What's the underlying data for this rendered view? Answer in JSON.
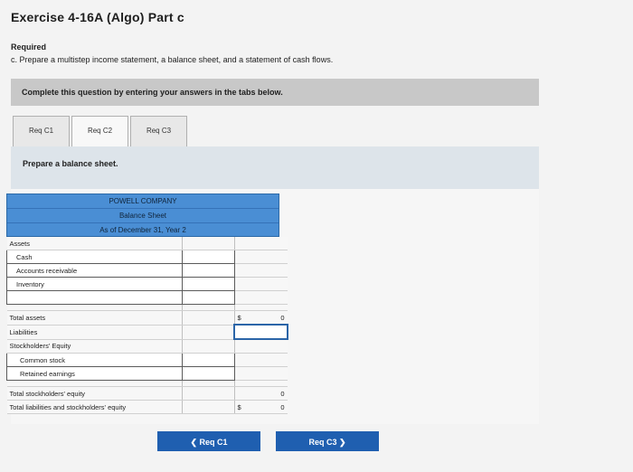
{
  "page": {
    "title": "Exercise 4-16A (Algo) Part c",
    "required_label": "Required",
    "required_text": "c. Prepare a multistep income statement, a balance sheet, and a statement of cash flows.",
    "instructions": "Complete this question by entering your answers in the tabs below."
  },
  "tabs": [
    {
      "label": "Req C1"
    },
    {
      "label": "Req C2"
    },
    {
      "label": "Req C3"
    }
  ],
  "panel": {
    "heading": "Prepare a balance sheet."
  },
  "balance_sheet": {
    "company": "POWELL COMPANY",
    "statement": "Balance Sheet",
    "date": "As of December 31, Year 2",
    "labels": {
      "assets": "Assets",
      "cash": "Cash",
      "accounts_receivable": "Accounts receivable",
      "inventory": "Inventory",
      "total_assets": "Total assets",
      "liabilities": "Liabilities",
      "stockholders_equity": "Stockholders' Equity",
      "common_stock": "Common stock",
      "retained_earnings": "Retained earnings",
      "total_stockholders_equity": "Total stockholders' equity",
      "total_liabilities_equity": "Total liabilities and stockholders' equity"
    },
    "values": {
      "currency": "$",
      "total_assets": "0",
      "total_stockholders_equity": "0",
      "total_liabilities_equity": "0"
    }
  },
  "nav": {
    "prev_label": "❮  Req C1",
    "next_label": "Req C3  ❯"
  }
}
